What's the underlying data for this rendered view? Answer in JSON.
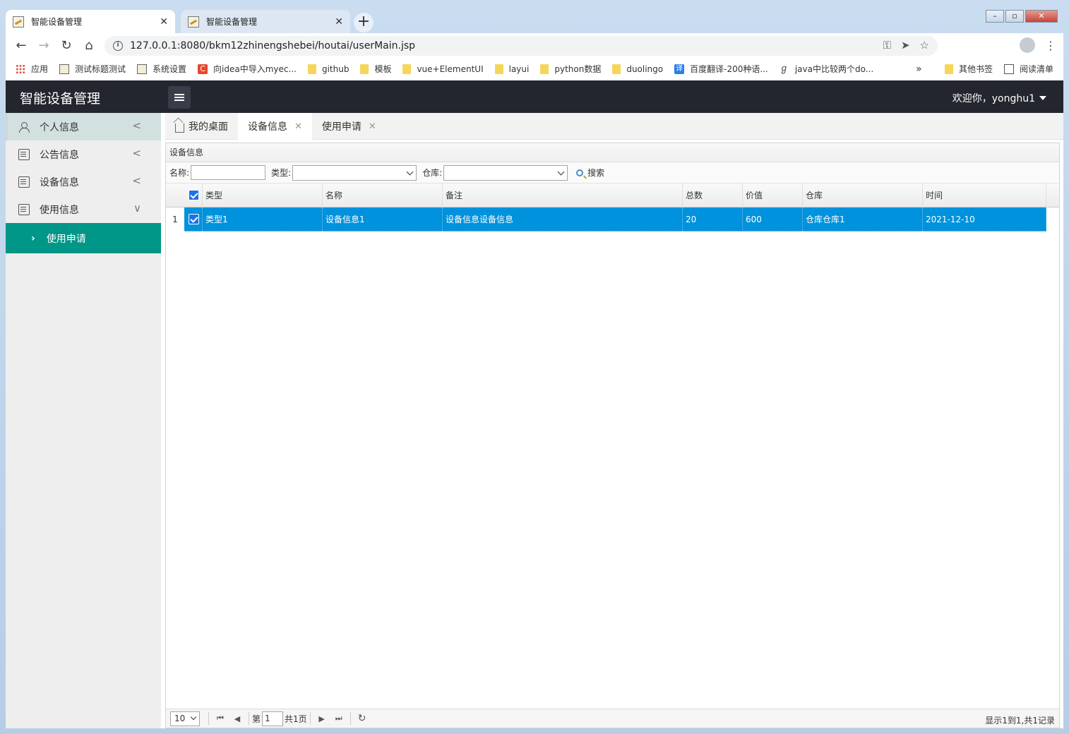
{
  "browser": {
    "tabs": [
      {
        "title": "智能设备管理"
      },
      {
        "title": "智能设备管理"
      }
    ],
    "url": "127.0.0.1:8080/bkm12zhinengshebei/houtai/userMain.jsp",
    "bookmarks": [
      {
        "label": "应用",
        "icon": "apps-icon"
      },
      {
        "label": "测试标题测试",
        "icon": "image-icon"
      },
      {
        "label": "系统设置",
        "icon": "image-icon"
      },
      {
        "label": "向idea中导入myec...",
        "icon": "csdn-icon"
      },
      {
        "label": "github",
        "icon": "folder-icon"
      },
      {
        "label": "模板",
        "icon": "folder-icon"
      },
      {
        "label": "vue+ElementUI",
        "icon": "folder-icon"
      },
      {
        "label": "layui",
        "icon": "folder-icon"
      },
      {
        "label": "python数据",
        "icon": "folder-icon"
      },
      {
        "label": "duolingo",
        "icon": "folder-icon"
      },
      {
        "label": "百度翻译-200种语...",
        "icon": "translate-icon"
      },
      {
        "label": "java中比较两个do...",
        "icon": "java-icon"
      }
    ],
    "bookmarks_more": "»",
    "other_bookmarks": "其他书签",
    "reading_list": "阅读清单"
  },
  "app": {
    "title": "智能设备管理",
    "welcome": "欢迎你，yonghu1"
  },
  "sidebar": {
    "items": [
      {
        "label": "个人信息",
        "icon": "user-icon",
        "arrow": "<"
      },
      {
        "label": "公告信息",
        "icon": "document-icon",
        "arrow": "<"
      },
      {
        "label": "设备信息",
        "icon": "document-icon",
        "arrow": "<"
      },
      {
        "label": "使用信息",
        "icon": "document-icon",
        "arrow": "∨"
      }
    ],
    "sub_item": {
      "label": "使用申请"
    }
  },
  "page_tabs": [
    {
      "label": "我的桌面"
    },
    {
      "label": "设备信息"
    },
    {
      "label": "使用申请"
    }
  ],
  "panel": {
    "title": "设备信息",
    "search": {
      "name_label": "名称:",
      "type_label": "类型:",
      "warehouse_label": "仓库:",
      "search_button": "搜索"
    }
  },
  "grid": {
    "columns": [
      "类型",
      "名称",
      "备注",
      "总数",
      "价值",
      "仓库",
      "时间"
    ],
    "rows": [
      {
        "num": "1",
        "cells": [
          "类型1",
          "设备信息1",
          "设备信息设备信息",
          "20",
          "600",
          "仓库仓库1",
          "2021-12-10"
        ]
      }
    ]
  },
  "pager": {
    "page_size": "10",
    "page_prefix": "第",
    "page_value": "1",
    "page_total": "共1页",
    "summary": "显示1到1,共1记录"
  }
}
